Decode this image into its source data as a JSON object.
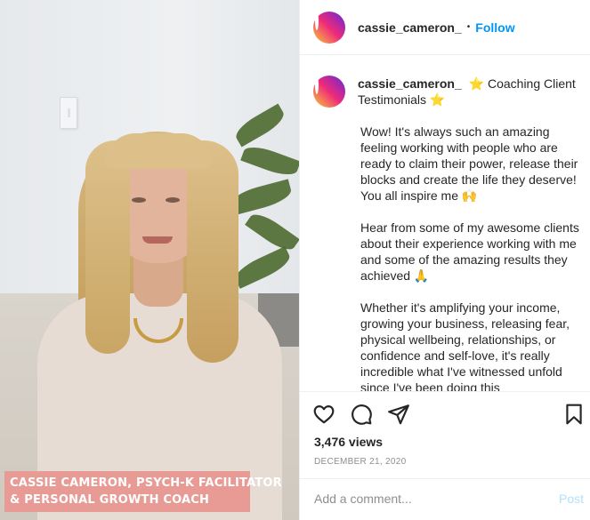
{
  "media": {
    "overlay_line1": "CASSIE CAMERON, PSYCH-K FACILITATOR",
    "overlay_line2": "& PERSONAL GROWTH COACH"
  },
  "header": {
    "username": "cassie_cameron_",
    "separator": "•",
    "follow_label": "Follow"
  },
  "caption": {
    "username": "cassie_cameron_",
    "title": "⭐ Coaching Client Testimonials ⭐",
    "paragraphs": [
      "Wow! It's always such an amazing feeling working with people who are ready to claim their power, release their blocks and create the life they deserve! You all inspire me 🙌",
      "Hear from some of my awesome clients about their experience working with me and some of the amazing results they achieved 🙏",
      "Whether it's amplifying your income, growing your business, releasing fear, physical wellbeing, relationships, or confidence and self-love, it's really incredible what I've witnessed unfold since I've been doing this"
    ]
  },
  "actions": {
    "like_icon": "heart-icon",
    "comment_icon": "comment-icon",
    "share_icon": "paper-plane-icon",
    "save_icon": "bookmark-icon",
    "views": "3,476 views",
    "date": "DECEMBER 21, 2020"
  },
  "comment_box": {
    "placeholder": "Add a comment...",
    "post_label": "Post"
  },
  "colors": {
    "link_blue": "#0095f6",
    "post_disabled": "#b2dffc",
    "overlay_pink": "#e89a94"
  }
}
